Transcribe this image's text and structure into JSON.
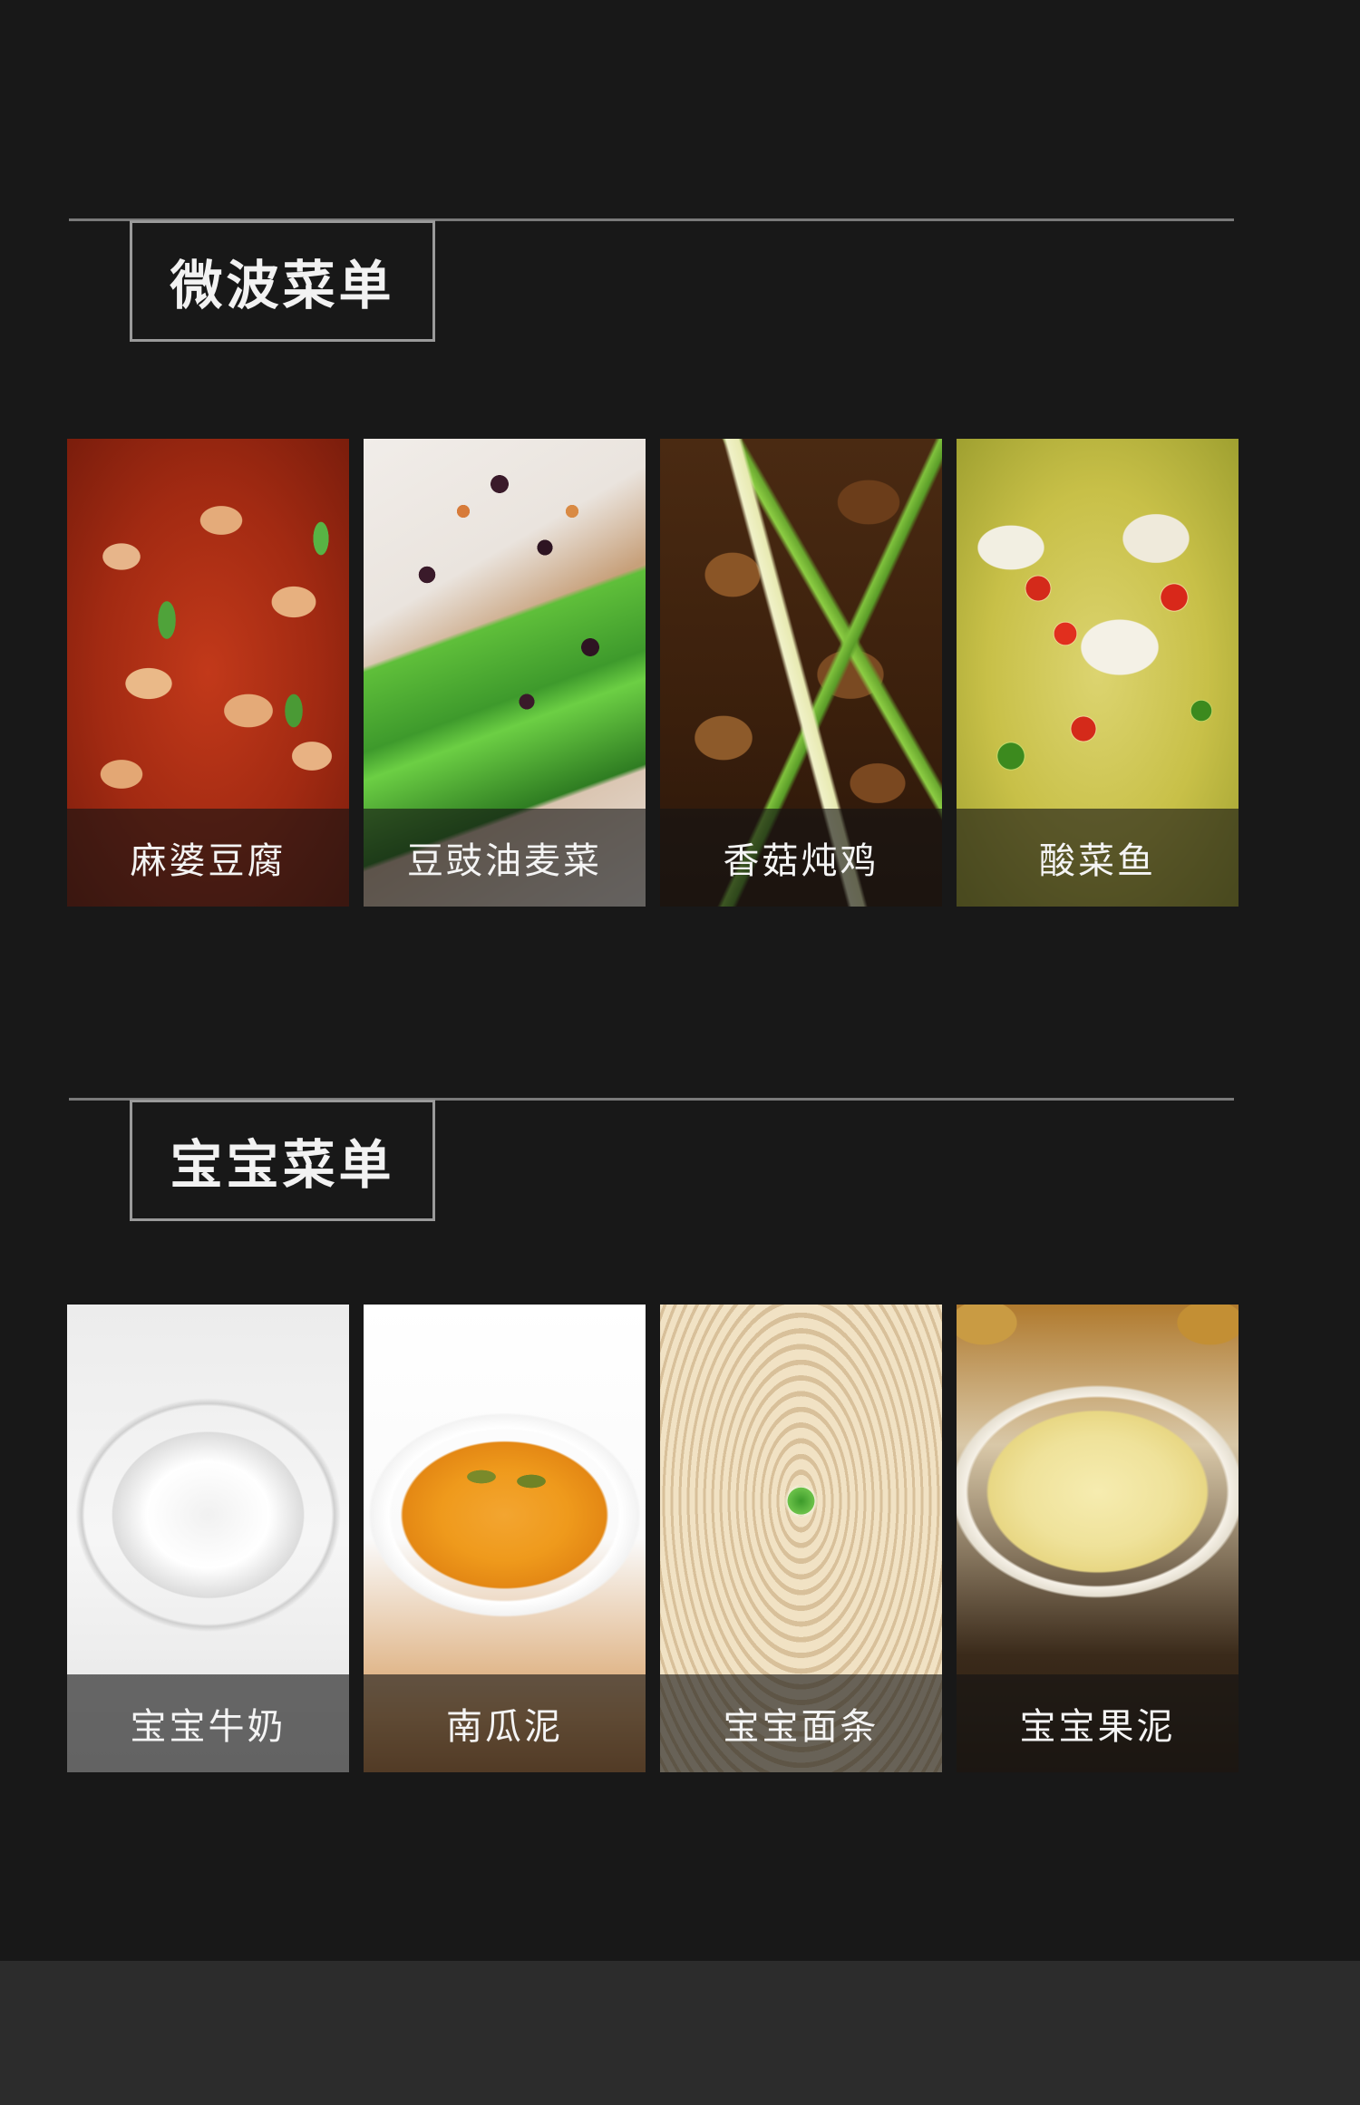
{
  "sections": [
    {
      "title": "微波菜单",
      "items": [
        {
          "label": "麻婆豆腐"
        },
        {
          "label": "豆豉油麦菜"
        },
        {
          "label": "香菇炖鸡"
        },
        {
          "label": "酸菜鱼"
        }
      ]
    },
    {
      "title": "宝宝菜单",
      "items": [
        {
          "label": "宝宝牛奶"
        },
        {
          "label": "南瓜泥"
        },
        {
          "label": "宝宝面条"
        },
        {
          "label": "宝宝果泥"
        }
      ]
    }
  ],
  "colors": {
    "background": "#181818",
    "rule": "#7a7a7a",
    "title_border": "#9a9a9a",
    "text": "#f2f2f2",
    "footer_band": "#2c2c2c"
  }
}
